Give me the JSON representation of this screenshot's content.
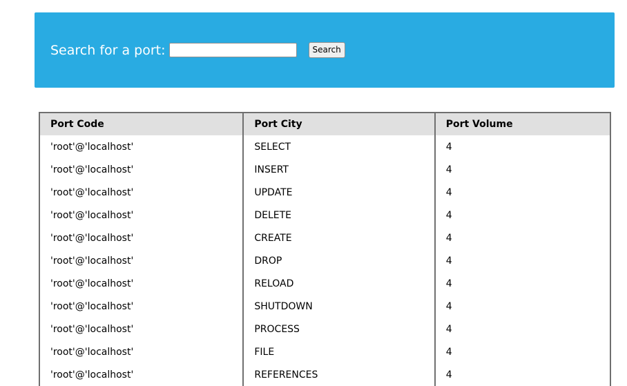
{
  "search": {
    "label": "Search for a port:",
    "input_value": "",
    "button_label": "Search"
  },
  "table": {
    "headers": {
      "code": "Port Code",
      "city": "Port City",
      "volume": "Port Volume"
    },
    "rows": [
      {
        "code": "'root'@'localhost'",
        "city": "SELECT",
        "volume": "4"
      },
      {
        "code": "'root'@'localhost'",
        "city": "INSERT",
        "volume": "4"
      },
      {
        "code": "'root'@'localhost'",
        "city": "UPDATE",
        "volume": "4"
      },
      {
        "code": "'root'@'localhost'",
        "city": "DELETE",
        "volume": "4"
      },
      {
        "code": "'root'@'localhost'",
        "city": "CREATE",
        "volume": "4"
      },
      {
        "code": "'root'@'localhost'",
        "city": "DROP",
        "volume": "4"
      },
      {
        "code": "'root'@'localhost'",
        "city": "RELOAD",
        "volume": "4"
      },
      {
        "code": "'root'@'localhost'",
        "city": "SHUTDOWN",
        "volume": "4"
      },
      {
        "code": "'root'@'localhost'",
        "city": "PROCESS",
        "volume": "4"
      },
      {
        "code": "'root'@'localhost'",
        "city": "FILE",
        "volume": "4"
      },
      {
        "code": "'root'@'localhost'",
        "city": "REFERENCES",
        "volume": "4"
      }
    ]
  },
  "colors": {
    "banner": "#29abe2",
    "header_row": "#e0e0e0",
    "table_border": "#6f6f6f"
  }
}
